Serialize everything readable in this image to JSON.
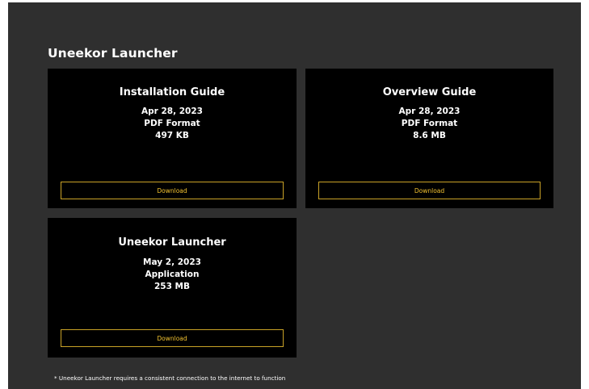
{
  "section": {
    "title": "Uneekor Launcher"
  },
  "cards": [
    {
      "title": "Installation Guide",
      "date": "Apr 28, 2023",
      "format": "PDF Format",
      "size": "497 KB",
      "button_label": "Download"
    },
    {
      "title": "Overview Guide",
      "date": "Apr 28, 2023",
      "format": "PDF Format",
      "size": "8.6 MB",
      "button_label": "Download"
    },
    {
      "title": "Uneekor Launcher",
      "date": "May 2, 2023",
      "format": "Application",
      "size": "253 MB",
      "button_label": "Download"
    }
  ],
  "footnote": "* Uneekor Launcher requires a consistent connection to the internet to function",
  "colors": {
    "panel_bg": "#2f2f2f",
    "card_bg": "#000000",
    "accent": "#f2c230",
    "accent_border": "#c9a227",
    "text": "#ffffff"
  }
}
